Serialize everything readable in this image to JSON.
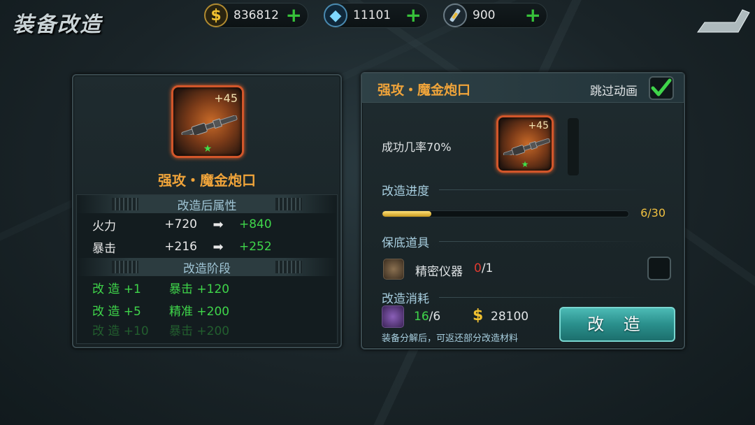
{
  "header": {
    "title": "装备改造",
    "currencies": [
      {
        "icon": "gold-coin-icon",
        "value": "836812",
        "color": "#e8b830"
      },
      {
        "icon": "diamond-icon",
        "value": "11101",
        "color": "#6fc8f0"
      },
      {
        "icon": "energy-tube-icon",
        "value": "900",
        "color": "#c8d8e0"
      }
    ],
    "back_icon": "back-arrow-icon"
  },
  "left_panel": {
    "item_level": "+45",
    "item_name": "强攻・魔金炮口",
    "attr_header": "改造后属性",
    "attributes": [
      {
        "name": "火力",
        "old": "+720",
        "new": "+840"
      },
      {
        "name": "暴击",
        "old": "+216",
        "new": "+252"
      }
    ],
    "stage_header": "改造阶段",
    "stages": [
      {
        "level": "改 造 +1",
        "bonus": "暴击 +120"
      },
      {
        "level": "改 造 +5",
        "bonus": "精准 +200"
      },
      {
        "level": "改 造 +10",
        "bonus": "暴击 +200"
      }
    ]
  },
  "right_panel": {
    "item_name": "强攻・魔金炮口",
    "skip_label": "跳过动画",
    "skip_checked": true,
    "success_rate": "成功几率70%",
    "item_level": "+45",
    "progress_label": "改造进度",
    "progress_current": 6,
    "progress_total": 30,
    "progress_text": "6/30",
    "guarantee_label": "保底道具",
    "tool_name": "精密仪器",
    "tool_have": "0",
    "tool_need": "/1",
    "cost_label": "改造消耗",
    "material_have": "16",
    "material_need": "/6",
    "gold_cost": "28100",
    "note": "装备分解后，可返还部分改造材料",
    "modify_button": "改 造"
  }
}
